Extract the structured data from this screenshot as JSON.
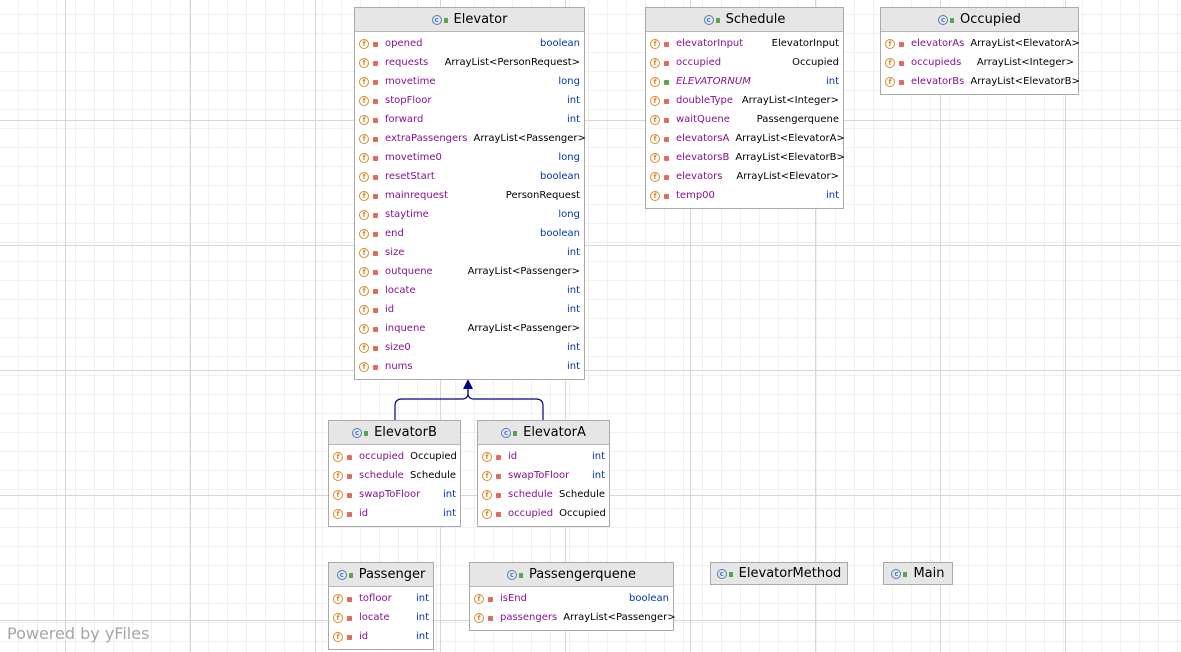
{
  "watermark": "Powered by yFiles",
  "colors": {
    "field_name": "#871094",
    "primitive_type": "#0037a6",
    "edge": "#00008b",
    "header_bg": "#e6e6e6"
  },
  "classes": {
    "elevator": {
      "name": "Elevator",
      "fields": [
        {
          "name": "opened",
          "type": "boolean"
        },
        {
          "name": "requests",
          "type": "ArrayList<PersonRequest>"
        },
        {
          "name": "movetime",
          "type": "long"
        },
        {
          "name": "stopFloor",
          "type": "int"
        },
        {
          "name": "forward",
          "type": "int"
        },
        {
          "name": "extraPassengers",
          "type": "ArrayList<Passenger>"
        },
        {
          "name": "movetime0",
          "type": "long"
        },
        {
          "name": "resetStart",
          "type": "boolean"
        },
        {
          "name": "mainrequest",
          "type": "PersonRequest"
        },
        {
          "name": "staytime",
          "type": "long"
        },
        {
          "name": "end",
          "type": "boolean"
        },
        {
          "name": "size",
          "type": "int"
        },
        {
          "name": "outquene",
          "type": "ArrayList<Passenger>"
        },
        {
          "name": "locate",
          "type": "int"
        },
        {
          "name": "id",
          "type": "int"
        },
        {
          "name": "inquene",
          "type": "ArrayList<Passenger>"
        },
        {
          "name": "size0",
          "type": "int"
        },
        {
          "name": "nums",
          "type": "int"
        }
      ]
    },
    "schedule": {
      "name": "Schedule",
      "fields": [
        {
          "name": "elevatorInput",
          "type": "ElevatorInput"
        },
        {
          "name": "occupied",
          "type": "Occupied"
        },
        {
          "name": "ELEVATORNUM",
          "type": "int"
        },
        {
          "name": "doubleType",
          "type": "ArrayList<Integer>"
        },
        {
          "name": "waitQuene",
          "type": "Passengerquene"
        },
        {
          "name": "elevatorsA",
          "type": "ArrayList<ElevatorA>"
        },
        {
          "name": "elevatorsB",
          "type": "ArrayList<ElevatorB>"
        },
        {
          "name": "elevators",
          "type": "ArrayList<Elevator>"
        },
        {
          "name": "temp00",
          "type": "int"
        }
      ]
    },
    "occupied": {
      "name": "Occupied",
      "fields": [
        {
          "name": "elevatorAs",
          "type": "ArrayList<ElevatorA>"
        },
        {
          "name": "occupieds",
          "type": "ArrayList<Integer>"
        },
        {
          "name": "elevatorBs",
          "type": "ArrayList<ElevatorB>"
        }
      ]
    },
    "elevatorB": {
      "name": "ElevatorB",
      "fields": [
        {
          "name": "occupied",
          "type": "Occupied"
        },
        {
          "name": "schedule",
          "type": "Schedule"
        },
        {
          "name": "swapToFloor",
          "type": "int"
        },
        {
          "name": "id",
          "type": "int"
        }
      ]
    },
    "elevatorA": {
      "name": "ElevatorA",
      "fields": [
        {
          "name": "id",
          "type": "int"
        },
        {
          "name": "swapToFloor",
          "type": "int"
        },
        {
          "name": "schedule",
          "type": "Schedule"
        },
        {
          "name": "occupied",
          "type": "Occupied"
        }
      ]
    },
    "passenger": {
      "name": "Passenger",
      "fields": [
        {
          "name": "tofloor",
          "type": "int"
        },
        {
          "name": "locate",
          "type": "int"
        },
        {
          "name": "id",
          "type": "int"
        }
      ]
    },
    "passengerquene": {
      "name": "Passengerquene",
      "fields": [
        {
          "name": "isEnd",
          "type": "boolean"
        },
        {
          "name": "passengers",
          "type": "ArrayList<Passenger>"
        }
      ]
    },
    "elevatorMethod": {
      "name": "ElevatorMethod",
      "fields": []
    },
    "main": {
      "name": "Main",
      "fields": []
    }
  }
}
